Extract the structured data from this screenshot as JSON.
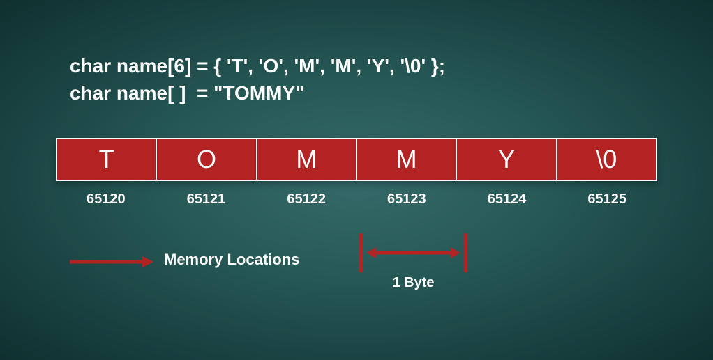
{
  "code": {
    "line1": "char name[6] = { 'T', 'O', 'M', 'M', 'Y', '\\0' };",
    "line2": "char name[ ]  = \"TOMMY\""
  },
  "cells": [
    "T",
    "O",
    "M",
    "M",
    "Y",
    "\\0"
  ],
  "addresses": [
    "65120",
    "65121",
    "65122",
    "65123",
    "65124",
    "65125"
  ],
  "labels": {
    "memory_locations": "Memory Locations",
    "one_byte": "1 Byte"
  },
  "colors": {
    "cell_bg": "#b32323",
    "arrow": "#b32323"
  }
}
